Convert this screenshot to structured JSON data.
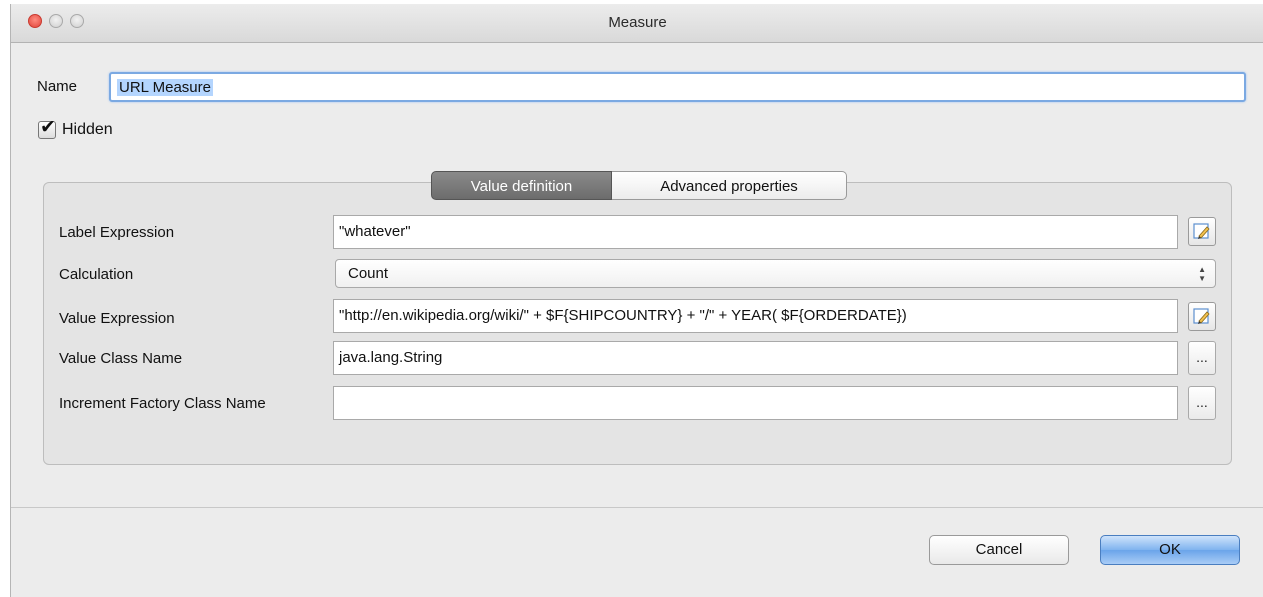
{
  "window": {
    "title": "Measure"
  },
  "name": {
    "label": "Name",
    "value": "URL Measure"
  },
  "hidden": {
    "label": "Hidden",
    "checked": true
  },
  "tabs": [
    {
      "label": "Value definition",
      "active": true
    },
    {
      "label": "Advanced properties",
      "active": false
    }
  ],
  "form": {
    "label_expression": {
      "label": "Label Expression",
      "value": "\"whatever\""
    },
    "calculation": {
      "label": "Calculation",
      "value": "Count"
    },
    "value_expression": {
      "label": "Value Expression",
      "value": "\"http://en.wikipedia.org/wiki/\" + $F{SHIPCOUNTRY} + \"/\" + YEAR( $F{ORDERDATE})"
    },
    "value_class_name": {
      "label": "Value Class Name",
      "value": "java.lang.String"
    },
    "increment_factory": {
      "label": "Increment Factory Class Name",
      "value": ""
    },
    "ellipsis": "..."
  },
  "buttons": {
    "cancel": "Cancel",
    "ok": "OK"
  },
  "icons": {
    "edit": "pencil-edit-icon",
    "checkmark": "checkmark-icon",
    "select_arrows": "up-down-arrows-icon"
  },
  "colors": {
    "accent": "#7ba9e2",
    "ok_button": "#6aa4ea",
    "tab_active": "#7a7a7a"
  }
}
